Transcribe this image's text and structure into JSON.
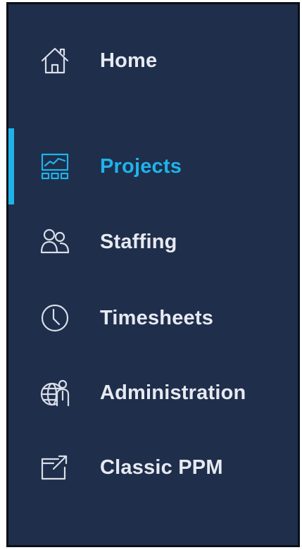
{
  "nav": {
    "items": [
      {
        "label": "Home",
        "icon": "home-icon",
        "active": false
      },
      {
        "label": "Projects",
        "icon": "projects-chart-icon",
        "active": true
      },
      {
        "label": "Staffing",
        "icon": "staffing-people-icon",
        "active": false
      },
      {
        "label": "Timesheets",
        "icon": "clock-icon",
        "active": false
      },
      {
        "label": "Administration",
        "icon": "globe-admin-icon",
        "active": false
      },
      {
        "label": "Classic PPM",
        "icon": "external-link-icon",
        "active": false
      }
    ]
  },
  "colors": {
    "sidebar_bg": "#1f2e4b",
    "text": "#e6eaf1",
    "accent": "#1fb3ea",
    "icon": "#d9dee8"
  }
}
